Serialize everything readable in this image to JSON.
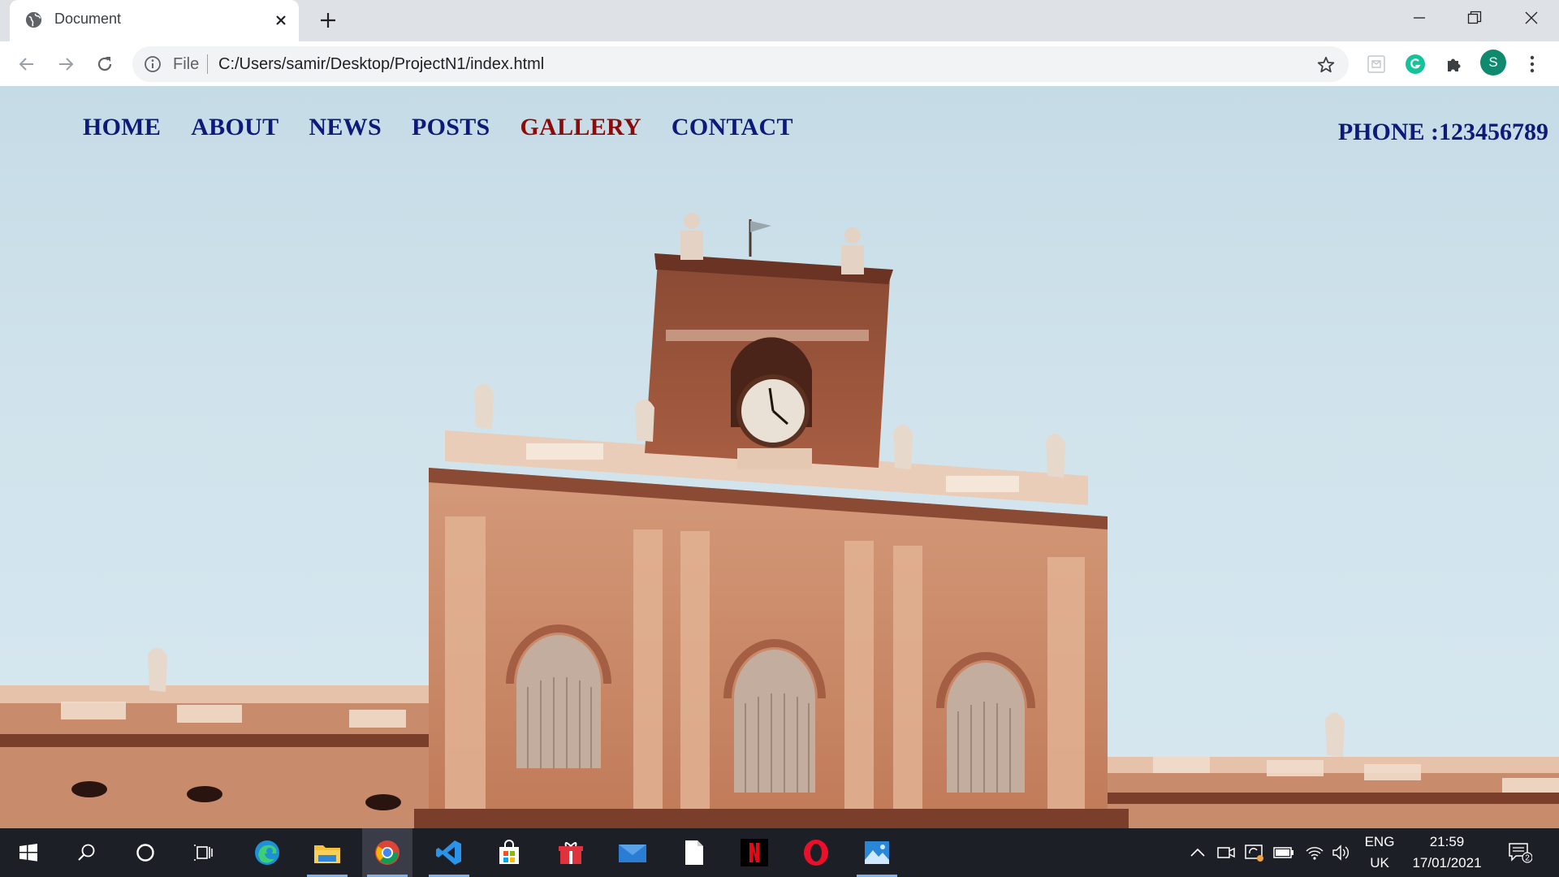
{
  "browser": {
    "tab_title": "Document",
    "omnibox": {
      "scheme_label": "File",
      "url": "C:/Users/samir/Desktop/ProjectN1/index.html"
    },
    "profile_initial": "S"
  },
  "page": {
    "nav": [
      "HOME",
      "ABOUT",
      "NEWS",
      "POSTS",
      "GALLERY",
      "CONTACT"
    ],
    "active_nav": "GALLERY",
    "phone": "PHONE :123456789",
    "colors": {
      "nav": "#0d1a7a",
      "active": "#8b0a0a"
    }
  },
  "taskbar": {
    "language": "ENG",
    "region": "UK",
    "time": "21:59",
    "date": "17/01/2021",
    "notifications": "2"
  }
}
